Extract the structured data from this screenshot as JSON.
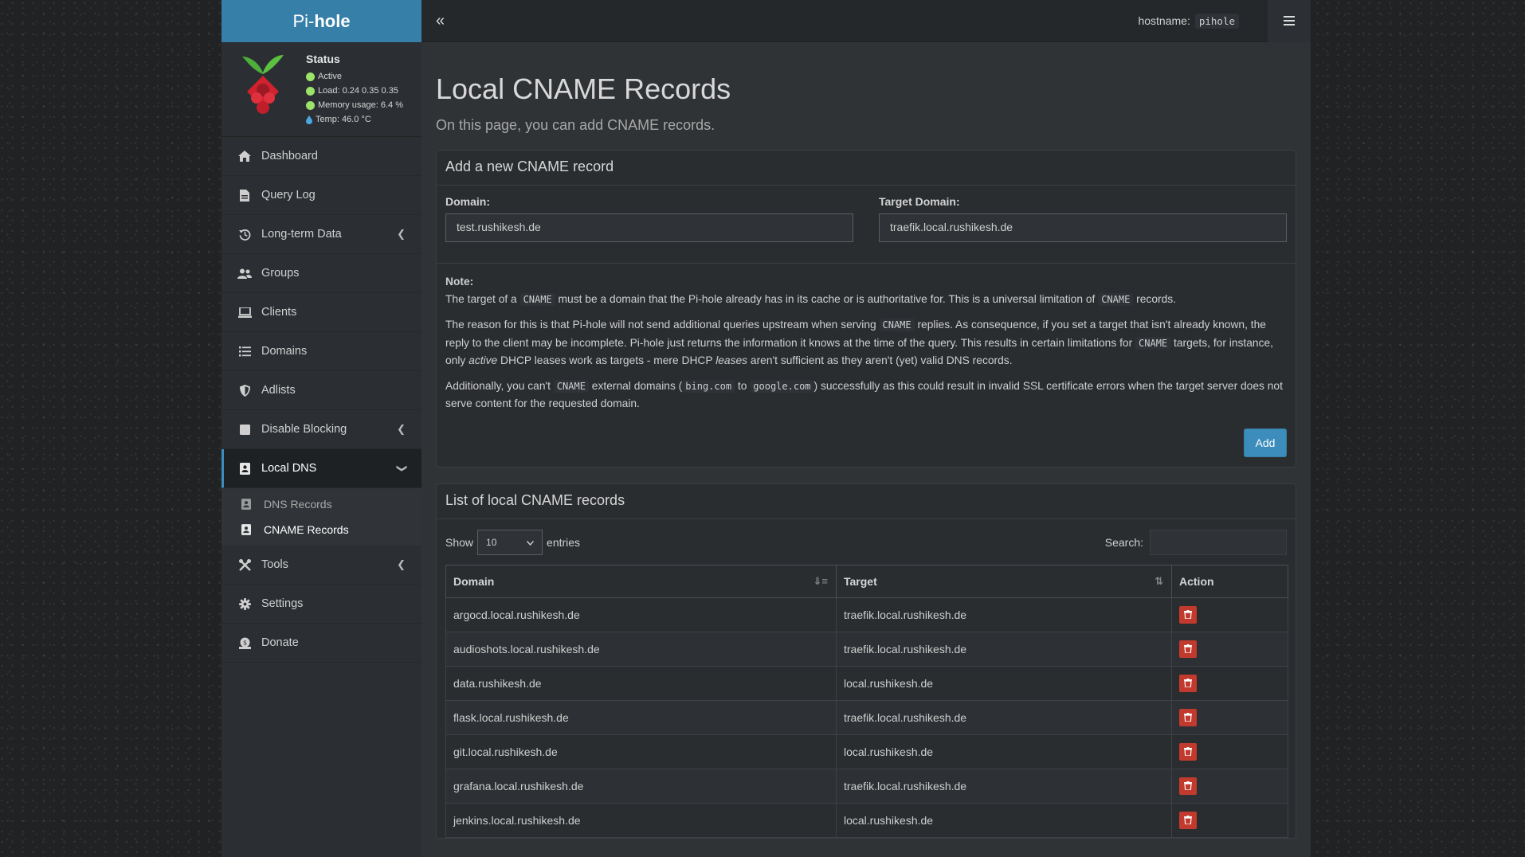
{
  "sidebar": {
    "logo_pre": "Pi-",
    "logo_bold": "hole",
    "status": {
      "title": "Status",
      "active": "Active",
      "load": "Load:  0.24  0.35  0.35",
      "memory": "Memory usage:  6.4 %",
      "temp": "Temp: 46.0 °C"
    },
    "items": [
      {
        "label": "Dashboard",
        "icon": "home-icon"
      },
      {
        "label": "Query Log",
        "icon": "file-icon"
      },
      {
        "label": "Long-term Data",
        "icon": "history-icon"
      },
      {
        "label": "Groups",
        "icon": "users-icon"
      },
      {
        "label": "Clients",
        "icon": "laptop-icon"
      },
      {
        "label": "Domains",
        "icon": "list-icon"
      },
      {
        "label": "Adlists",
        "icon": "shield-icon"
      },
      {
        "label": "Disable Blocking",
        "icon": "stop-icon"
      },
      {
        "label": "Local DNS",
        "icon": "address-book-icon"
      },
      {
        "label": "Tools",
        "icon": "tools-icon"
      },
      {
        "label": "Settings",
        "icon": "gear-icon"
      },
      {
        "label": "Donate",
        "icon": "donate-icon"
      }
    ],
    "subitems": [
      {
        "label": "DNS Records"
      },
      {
        "label": "CNAME Records"
      }
    ]
  },
  "topbar": {
    "hostname_label": "hostname:",
    "hostname_value": "pihole"
  },
  "page": {
    "title": "Local CNAME Records",
    "subtitle": "On this page, you can add CNAME records."
  },
  "add_form": {
    "header": "Add a new CNAME record",
    "domain_label": "Domain:",
    "domain_value": "test.rushikesh.de",
    "target_label": "Target Domain:",
    "target_value": "traefik.local.rushikesh.de",
    "note_title": "Note:",
    "add_label": "Add"
  },
  "note": {
    "p1_a": "The target of a ",
    "p1_code": "CNAME",
    "p1_b": " must be a domain that the Pi-hole already has in its cache or is authoritative for. This is a universal limitation of ",
    "p1_c": " records.",
    "p2_a": "The reason for this is that Pi-hole will not send additional queries upstream when serving ",
    "p2_b": " replies. As consequence, if you set a target that isn't already known, the reply to the client may be incomplete. Pi-hole just returns the information it knows at the time of the query. This results in certain limitations for ",
    "p2_c": " targets, for instance, only ",
    "p2_em1": "active",
    "p2_d": " DHCP leases work as targets - mere DHCP ",
    "p2_em2": "leases",
    "p2_e": " aren't sufficient as they aren't (yet) valid DNS records.",
    "p3_a": "Additionally, you can't ",
    "p3_b": " external domains (",
    "p3_code2": "bing.com",
    "p3_c": " to ",
    "p3_code3": "google.com",
    "p3_d": ") successfully as this could result in invalid SSL certificate errors when the target server does not serve content for the requested domain."
  },
  "list": {
    "header": "List of local CNAME records",
    "show_label": "Show",
    "entries_value": "10",
    "entries_label": "entries",
    "search_label": "Search:",
    "columns": [
      "Domain",
      "Target",
      "Action"
    ],
    "rows": [
      {
        "domain": "argocd.local.rushikesh.de",
        "target": "traefik.local.rushikesh.de"
      },
      {
        "domain": "audioshots.local.rushikesh.de",
        "target": "traefik.local.rushikesh.de"
      },
      {
        "domain": "data.rushikesh.de",
        "target": "local.rushikesh.de"
      },
      {
        "domain": "flask.local.rushikesh.de",
        "target": "traefik.local.rushikesh.de"
      },
      {
        "domain": "git.local.rushikesh.de",
        "target": "local.rushikesh.de"
      },
      {
        "domain": "grafana.local.rushikesh.de",
        "target": "traefik.local.rushikesh.de"
      },
      {
        "domain": "jenkins.local.rushikesh.de",
        "target": "local.rushikesh.de"
      }
    ]
  },
  "colors": {
    "accent": "#3c8dbc",
    "danger": "#c23a2e",
    "status_green": "#9be36b"
  }
}
